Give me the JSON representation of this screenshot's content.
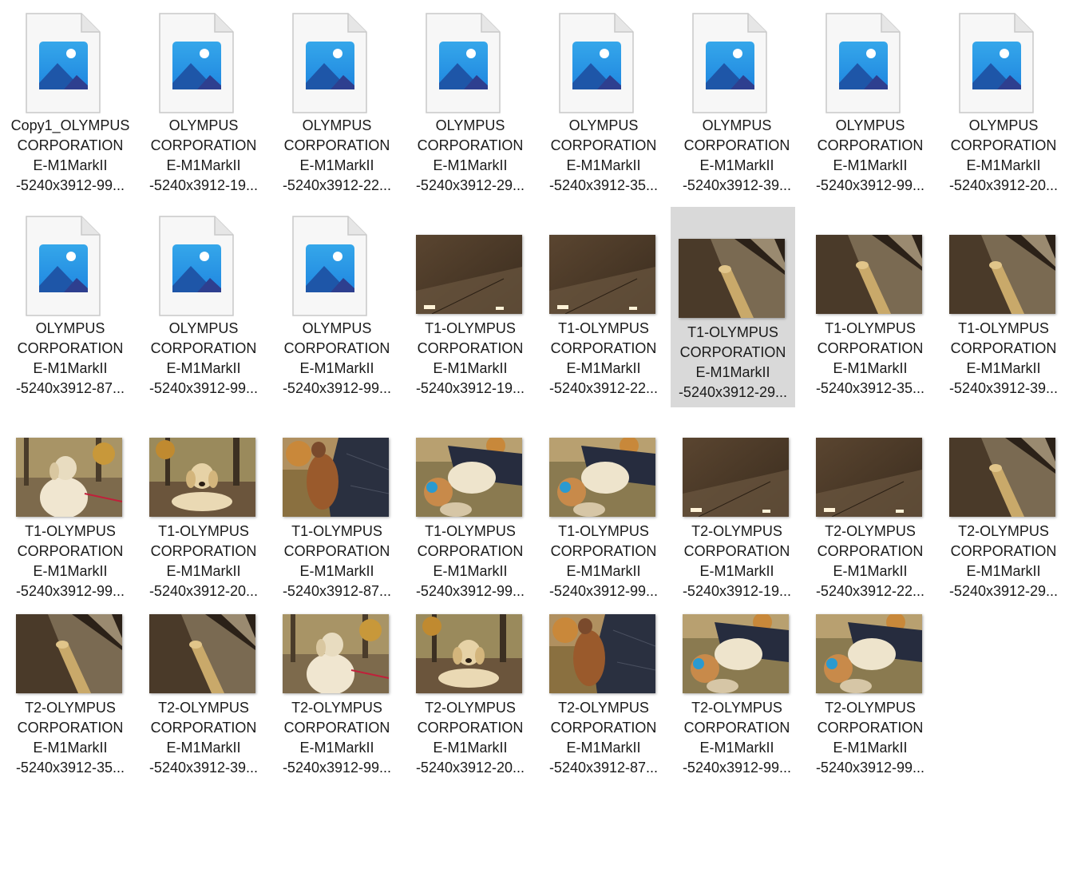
{
  "colors": {
    "selection": "#d9d9d9",
    "text": "#1a1a1a",
    "icon_blue": "#1f86e0"
  },
  "files": [
    {
      "lines": [
        "Copy1_OLYMPUS",
        "CORPORATION",
        "E-M1MarkII",
        "-5240x3912-99..."
      ],
      "thumb": "generic-image-icon"
    },
    {
      "lines": [
        "OLYMPUS",
        "CORPORATION",
        "E-M1MarkII",
        "-5240x3912-19..."
      ],
      "thumb": "generic-image-icon"
    },
    {
      "lines": [
        "OLYMPUS",
        "CORPORATION",
        "E-M1MarkII",
        "-5240x3912-22..."
      ],
      "thumb": "generic-image-icon"
    },
    {
      "lines": [
        "OLYMPUS",
        "CORPORATION",
        "E-M1MarkII",
        "-5240x3912-29..."
      ],
      "thumb": "generic-image-icon"
    },
    {
      "lines": [
        "OLYMPUS",
        "CORPORATION",
        "E-M1MarkII",
        "-5240x3912-35..."
      ],
      "thumb": "generic-image-icon"
    },
    {
      "lines": [
        "OLYMPUS",
        "CORPORATION",
        "E-M1MarkII",
        "-5240x3912-39..."
      ],
      "thumb": "generic-image-icon"
    },
    {
      "lines": [
        "OLYMPUS",
        "CORPORATION",
        "E-M1MarkII",
        "-5240x3912-99..."
      ],
      "thumb": "generic-image-icon"
    },
    {
      "lines": [
        "OLYMPUS",
        "CORPORATION",
        "E-M1MarkII",
        "-5240x3912-20..."
      ],
      "thumb": "generic-image-icon"
    },
    {
      "lines": [
        "OLYMPUS",
        "CORPORATION",
        "E-M1MarkII",
        "-5240x3912-87..."
      ],
      "thumb": "generic-image-icon"
    },
    {
      "lines": [
        "OLYMPUS",
        "CORPORATION",
        "E-M1MarkII",
        "-5240x3912-99..."
      ],
      "thumb": "generic-image-icon"
    },
    {
      "lines": [
        "OLYMPUS",
        "CORPORATION",
        "E-M1MarkII",
        "-5240x3912-99..."
      ],
      "thumb": "generic-image-icon"
    },
    {
      "lines": [
        "T1-OLYMPUS",
        "CORPORATION",
        "E-M1MarkII",
        "-5240x3912-19..."
      ],
      "thumb": "ceiling"
    },
    {
      "lines": [
        "T1-OLYMPUS",
        "CORPORATION",
        "E-M1MarkII",
        "-5240x3912-22..."
      ],
      "thumb": "ceiling"
    },
    {
      "lines": [
        "T1-OLYMPUS",
        "CORPORATION",
        "E-M1MarkII",
        "-5240x3912-29..."
      ],
      "thumb": "pillar",
      "selected": true
    },
    {
      "lines": [
        "T1-OLYMPUS",
        "CORPORATION",
        "E-M1MarkII",
        "-5240x3912-35..."
      ],
      "thumb": "pillar"
    },
    {
      "lines": [
        "T1-OLYMPUS",
        "CORPORATION",
        "E-M1MarkII",
        "-5240x3912-39..."
      ],
      "thumb": "pillar"
    },
    {
      "lines": [
        "T1-OLYMPUS",
        "CORPORATION",
        "E-M1MarkII",
        "-5240x3912-99..."
      ],
      "thumb": "dog-sitting"
    },
    {
      "lines": [
        "T1-OLYMPUS",
        "CORPORATION",
        "E-M1MarkII",
        "-5240x3912-20..."
      ],
      "thumb": "dog-lying"
    },
    {
      "lines": [
        "T1-OLYMPUS",
        "CORPORATION",
        "E-M1MarkII",
        "-5240x3912-87..."
      ],
      "thumb": "dog-person"
    },
    {
      "lines": [
        "T1-OLYMPUS",
        "CORPORATION",
        "E-M1MarkII",
        "-5240x3912-99..."
      ],
      "thumb": "dog-rolling"
    },
    {
      "lines": [
        "T1-OLYMPUS",
        "CORPORATION",
        "E-M1MarkII",
        "-5240x3912-99..."
      ],
      "thumb": "dog-rolling"
    },
    {
      "lines": [
        "T2-OLYMPUS",
        "CORPORATION",
        "E-M1MarkII",
        "-5240x3912-19..."
      ],
      "thumb": "ceiling"
    },
    {
      "lines": [
        "T2-OLYMPUS",
        "CORPORATION",
        "E-M1MarkII",
        "-5240x3912-22..."
      ],
      "thumb": "ceiling"
    },
    {
      "lines": [
        "T2-OLYMPUS",
        "CORPORATION",
        "E-M1MarkII",
        "-5240x3912-29..."
      ],
      "thumb": "pillar"
    },
    {
      "lines": [
        "T2-OLYMPUS",
        "CORPORATION",
        "E-M1MarkII",
        "-5240x3912-35..."
      ],
      "thumb": "pillar"
    },
    {
      "lines": [
        "T2-OLYMPUS",
        "CORPORATION",
        "E-M1MarkII",
        "-5240x3912-39..."
      ],
      "thumb": "pillar"
    },
    {
      "lines": [
        "T2-OLYMPUS",
        "CORPORATION",
        "E-M1MarkII",
        "-5240x3912-99..."
      ],
      "thumb": "dog-sitting"
    },
    {
      "lines": [
        "T2-OLYMPUS",
        "CORPORATION",
        "E-M1MarkII",
        "-5240x3912-20..."
      ],
      "thumb": "dog-lying"
    },
    {
      "lines": [
        "T2-OLYMPUS",
        "CORPORATION",
        "E-M1MarkII",
        "-5240x3912-87..."
      ],
      "thumb": "dog-person"
    },
    {
      "lines": [
        "T2-OLYMPUS",
        "CORPORATION",
        "E-M1MarkII",
        "-5240x3912-99..."
      ],
      "thumb": "dog-rolling"
    },
    {
      "lines": [
        "T2-OLYMPUS",
        "CORPORATION",
        "E-M1MarkII",
        "-5240x3912-99..."
      ],
      "thumb": "dog-rolling"
    }
  ]
}
